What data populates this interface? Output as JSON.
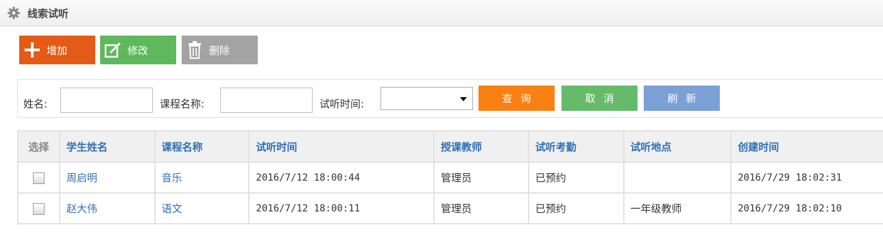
{
  "header": {
    "title": "线索试听",
    "icon": "gear-icon"
  },
  "toolbar": {
    "add_label": "增加",
    "add_color": "#e35b17",
    "edit_label": "修改",
    "edit_color": "#5fb85c",
    "delete_label": "删除",
    "delete_color": "#a3a3a3"
  },
  "search": {
    "name_label": "姓名:",
    "name_value": "",
    "course_label": "课程名称:",
    "course_value": "",
    "time_label": "试听时间:",
    "time_selected": "",
    "query_label": "查询",
    "cancel_label": "取消",
    "refresh_label": "刷新"
  },
  "table": {
    "columns": [
      "选择",
      "学生姓名",
      "课程名称",
      "试听时间",
      "授课教师",
      "试听考勤",
      "试听地点",
      "创建时间"
    ],
    "rows": [
      {
        "student": "周启明",
        "course": "音乐",
        "time": "2016/7/12 18:00:44",
        "teacher": "管理员",
        "attendance": "已预约",
        "location": "",
        "created": "2016/7/29 18:02:31"
      },
      {
        "student": "赵大伟",
        "course": "语文",
        "time": "2016/7/12 18:00:11",
        "teacher": "管理员",
        "attendance": "已预约",
        "location": "一年级教师",
        "created": "2016/7/29 18:02:10"
      }
    ]
  }
}
